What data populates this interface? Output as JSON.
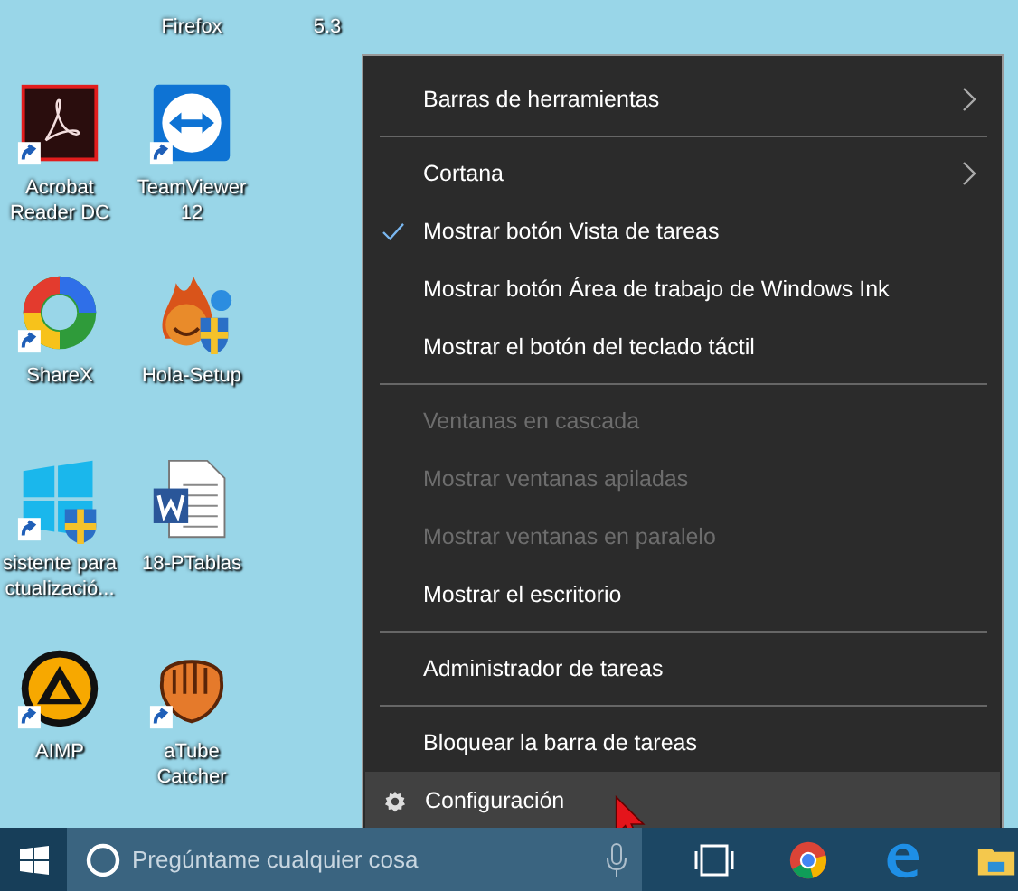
{
  "desktop": {
    "columns": [
      {
        "icons": [
          {
            "kind": "pdf",
            "label": "Acrobat Reader DC",
            "shortcut": true
          },
          {
            "kind": "ring",
            "label": "ShareX",
            "shortcut": true
          },
          {
            "kind": "windows",
            "label": "sistente para ctualizació...",
            "shortcut": true
          },
          {
            "kind": "triangle",
            "label": "AIMP",
            "shortcut": true
          }
        ]
      },
      {
        "top_label": "Firefox",
        "icons": [
          {
            "kind": "arrows",
            "label": "TeamViewer 12",
            "shortcut": true
          },
          {
            "kind": "flame",
            "label": "Hola-Setup",
            "shortcut": false
          },
          {
            "kind": "word",
            "label": "18-PTablas",
            "shortcut": false
          },
          {
            "kind": "glove",
            "label": "aTube Catcher",
            "shortcut": true
          }
        ]
      },
      {
        "top_label": "5.3"
      }
    ]
  },
  "context_menu": {
    "items": [
      {
        "kind": "item",
        "label": "Barras de herramientas",
        "submenu": true,
        "checked": false,
        "disabled": false,
        "selected": false
      },
      {
        "kind": "separator"
      },
      {
        "kind": "item",
        "label": "Cortana",
        "submenu": true,
        "checked": false,
        "disabled": false,
        "selected": false
      },
      {
        "kind": "item",
        "label": "Mostrar botón Vista de tareas",
        "submenu": false,
        "checked": true,
        "disabled": false,
        "selected": false
      },
      {
        "kind": "item",
        "label": "Mostrar botón Área de trabajo de Windows Ink",
        "submenu": false,
        "checked": false,
        "disabled": false,
        "selected": false
      },
      {
        "kind": "item",
        "label": "Mostrar el botón del teclado táctil",
        "submenu": false,
        "checked": false,
        "disabled": false,
        "selected": false
      },
      {
        "kind": "separator"
      },
      {
        "kind": "item",
        "label": "Ventanas en cascada",
        "submenu": false,
        "checked": false,
        "disabled": true,
        "selected": false
      },
      {
        "kind": "item",
        "label": "Mostrar ventanas apiladas",
        "submenu": false,
        "checked": false,
        "disabled": true,
        "selected": false
      },
      {
        "kind": "item",
        "label": "Mostrar ventanas en paralelo",
        "submenu": false,
        "checked": false,
        "disabled": true,
        "selected": false
      },
      {
        "kind": "item",
        "label": "Mostrar el escritorio",
        "submenu": false,
        "checked": false,
        "disabled": false,
        "selected": false
      },
      {
        "kind": "separator"
      },
      {
        "kind": "item",
        "label": "Administrador de tareas",
        "submenu": false,
        "checked": false,
        "disabled": false,
        "selected": false
      },
      {
        "kind": "separator"
      },
      {
        "kind": "item",
        "label": "Bloquear la barra de tareas",
        "submenu": false,
        "checked": false,
        "disabled": false,
        "selected": false
      },
      {
        "kind": "settings",
        "label": "Configuración",
        "submenu": false,
        "checked": false,
        "disabled": false,
        "selected": true
      }
    ]
  },
  "taskbar": {
    "search": {
      "placeholder": "Pregúntame cualquier cosa"
    },
    "apps": [
      {
        "kind": "taskview"
      },
      {
        "kind": "browser"
      },
      {
        "kind": "edge"
      },
      {
        "kind": "folder"
      }
    ]
  }
}
